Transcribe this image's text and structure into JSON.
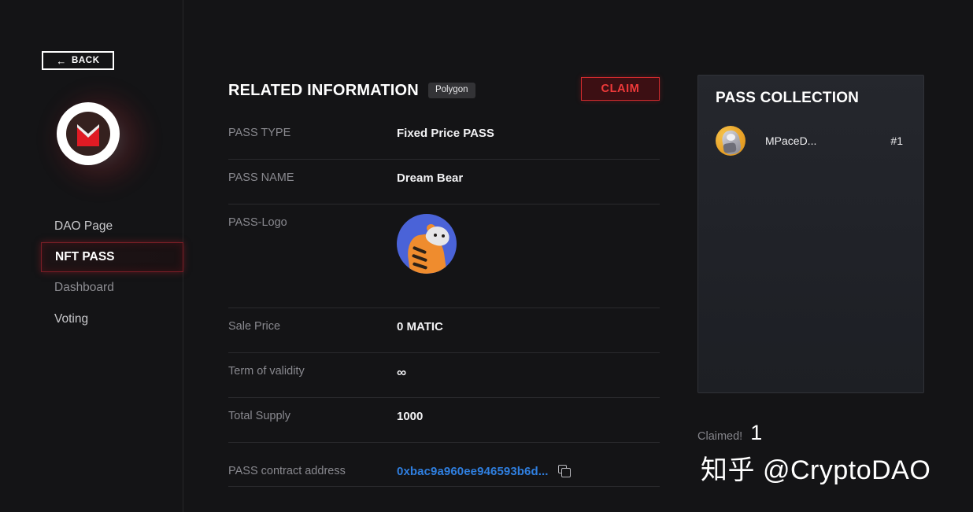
{
  "sidebar": {
    "back_label": "BACK",
    "back_arrow": "←",
    "logo_name": "dao-logo",
    "nav": [
      {
        "label": "DAO Page",
        "state": "default"
      },
      {
        "label": "NFT PASS",
        "state": "active"
      },
      {
        "label": "Dashboard",
        "state": "dim"
      },
      {
        "label": "Voting",
        "state": "default"
      }
    ]
  },
  "main": {
    "section_title": "RELATED INFORMATION",
    "chain_badge": "Polygon",
    "claim_label": "CLAIM",
    "rows": {
      "pass_type": {
        "label": "PASS TYPE",
        "value": "Fixed Price PASS"
      },
      "pass_name": {
        "label": "PASS NAME",
        "value": "Dream Bear"
      },
      "pass_logo": {
        "label": "PASS-Logo",
        "value": ""
      },
      "sale_price": {
        "label": "Sale Price",
        "value": "0 MATIC"
      },
      "term": {
        "label": "Term of validity",
        "value": "∞"
      },
      "total_supply": {
        "label": "Total Supply",
        "value": "1000"
      },
      "contract": {
        "label": "PASS contract address",
        "value": "0xbac9a960ee946593b6d..."
      }
    },
    "copy_icon": "copy-icon"
  },
  "collection": {
    "title": "PASS COLLECTION",
    "items": [
      {
        "name": "MPaceD...",
        "id": "#1"
      }
    ]
  },
  "footer": {
    "claimed_label": "Claimed!",
    "claimed_count": "1",
    "watermark_cn": "知乎",
    "watermark_handle": "@CryptoDAO"
  },
  "colors": {
    "background": "#141416",
    "accent_red": "#d42b2e",
    "claim_text": "#f03a3a",
    "link_blue": "#2f7fe0",
    "panel_bg": "#25272d",
    "label_grey": "#89898f"
  }
}
